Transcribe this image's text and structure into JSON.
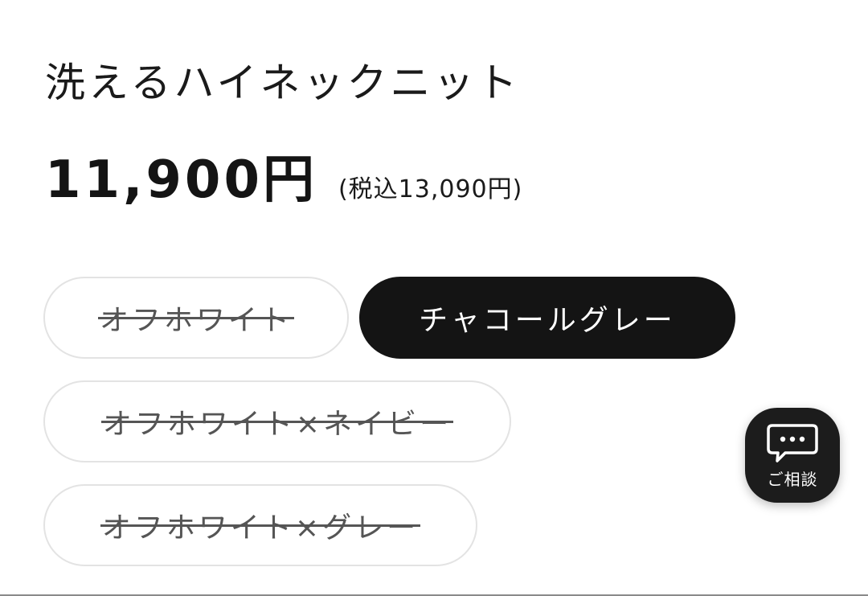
{
  "product": {
    "title": "洗えるハイネックニット",
    "price": "11,900円",
    "price_tax_included": "(税込13,090円)"
  },
  "variants": [
    {
      "label": "オフホワイト",
      "state": "sold-out"
    },
    {
      "label": "チャコールグレー",
      "state": "selected"
    },
    {
      "label": "オフホワイト×ネイビー",
      "state": "sold-out"
    },
    {
      "label": "オフホワイト×グレー",
      "state": "sold-out"
    }
  ],
  "chat": {
    "label": "ご相談",
    "icon": "chat-bubble-icon"
  },
  "colors": {
    "selected_bg": "#141414",
    "pill_border": "#e3e3e3",
    "soldout_text": "#555555"
  }
}
